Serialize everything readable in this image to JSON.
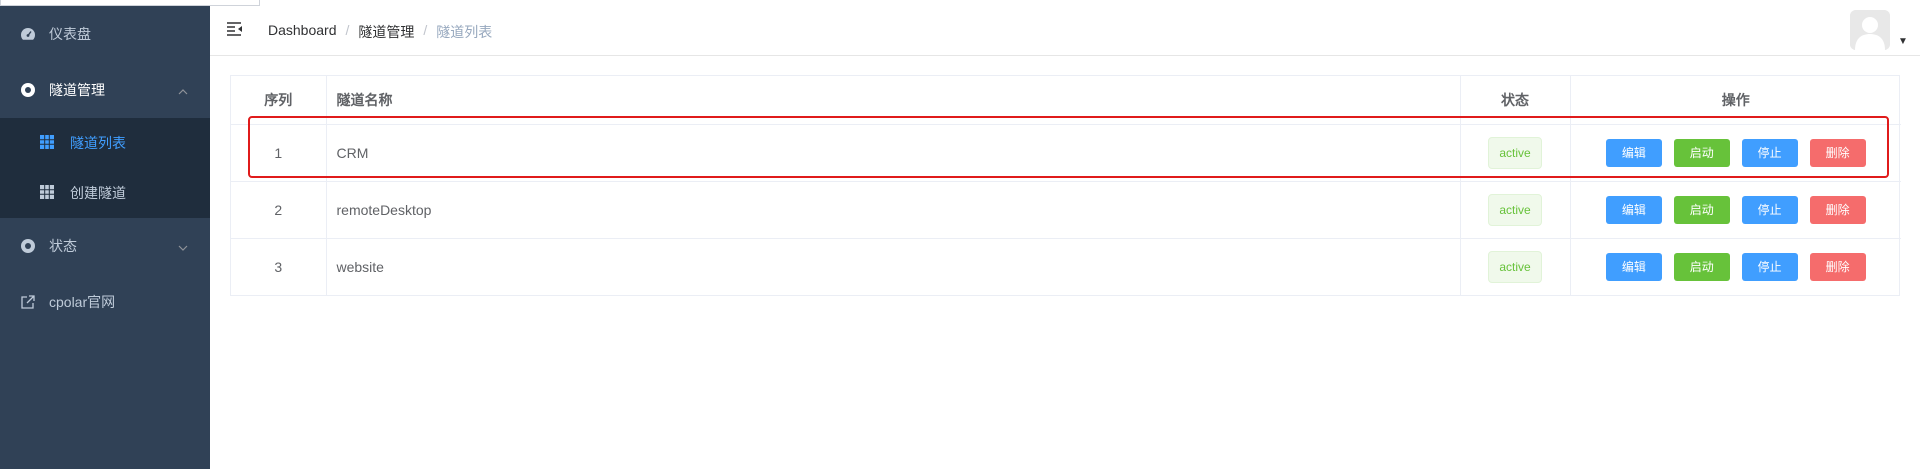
{
  "sidebar": {
    "items": [
      {
        "label": "仪表盘",
        "icon": "dashboard-icon"
      },
      {
        "label": "隧道管理",
        "icon": "tunnel-icon",
        "expanded": true
      },
      {
        "label": "状态",
        "icon": "status-icon"
      },
      {
        "label": "cpolar官网",
        "icon": "external-link-icon"
      }
    ],
    "submenu": [
      {
        "label": "隧道列表",
        "icon": "grid-icon",
        "active": true
      },
      {
        "label": "创建隧道",
        "icon": "grid-icon"
      }
    ]
  },
  "header": {
    "breadcrumb": [
      "Dashboard",
      "隧道管理",
      "隧道列表"
    ],
    "breadcrumb_separator": "/"
  },
  "table": {
    "headers": [
      "序列",
      "隧道名称",
      "状态",
      "操作"
    ],
    "actions": [
      "编辑",
      "启动",
      "停止",
      "删除"
    ],
    "rows": [
      {
        "index": "1",
        "name": "CRM",
        "status": "active"
      },
      {
        "index": "2",
        "name": "remoteDesktop",
        "status": "active"
      },
      {
        "index": "3",
        "name": "website",
        "status": "active"
      }
    ]
  },
  "colors": {
    "sidebar_bg": "#304156",
    "submenu_bg": "#1f2d3d",
    "active": "#409eff",
    "success": "#67c23a",
    "danger": "#f56c6c",
    "highlight": "#e01b1b"
  }
}
